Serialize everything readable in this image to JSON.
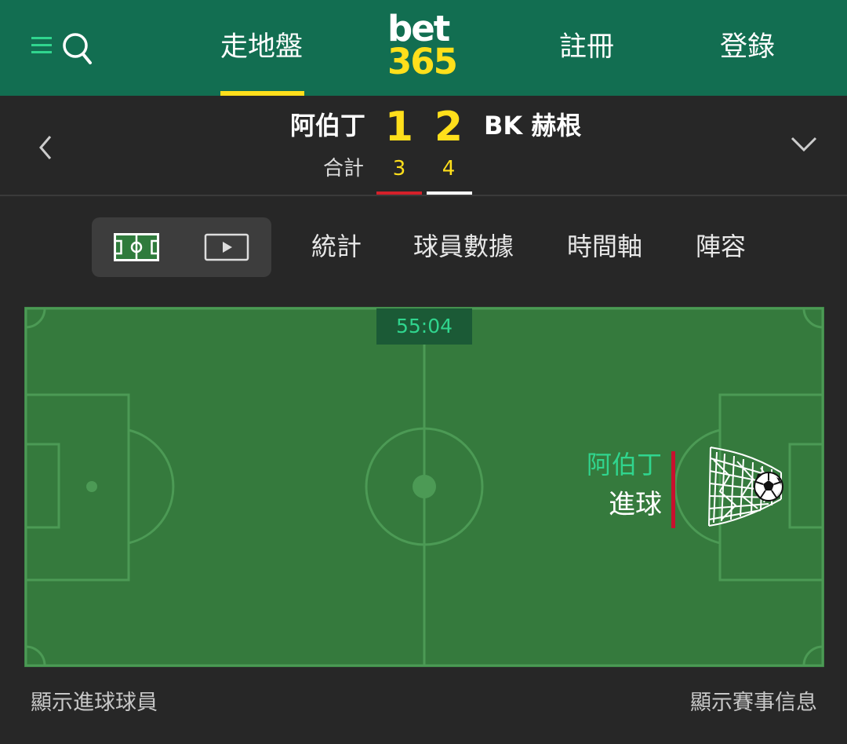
{
  "header": {
    "menu_icon": "menu-icon",
    "search_icon": "search-icon",
    "nav_live": "走地盤",
    "logo_top": "bet",
    "logo_bottom": "365",
    "nav_register": "註冊",
    "nav_login": "登錄",
    "colors": {
      "background": "#126e51",
      "accent": "#ffdf1b"
    }
  },
  "match": {
    "home_team": "阿伯丁",
    "away_team": "BK 赫根",
    "home_score": "1",
    "away_score": "2",
    "aggregate_label": "合計",
    "home_aggregate": "3",
    "away_aggregate": "4",
    "home_color": "#d4202a",
    "away_color": "#ffffff"
  },
  "tabs": {
    "pitch_view_icon": "pitch-icon",
    "video_view_icon": "play-icon",
    "stats": "統計",
    "player_data": "球員數據",
    "timeline": "時間軸",
    "lineup": "陣容"
  },
  "pitch": {
    "clock": "55:04",
    "event_team": "阿伯丁",
    "event_type": "進球",
    "event_icon": "goal-net-ball-icon",
    "colors": {
      "grass": "#357a3d",
      "lines": "#4c9a55",
      "event_bar": "#c8102e"
    }
  },
  "footer": {
    "show_scorers": "顯示進球球員",
    "show_match_info": "顯示賽事信息"
  }
}
